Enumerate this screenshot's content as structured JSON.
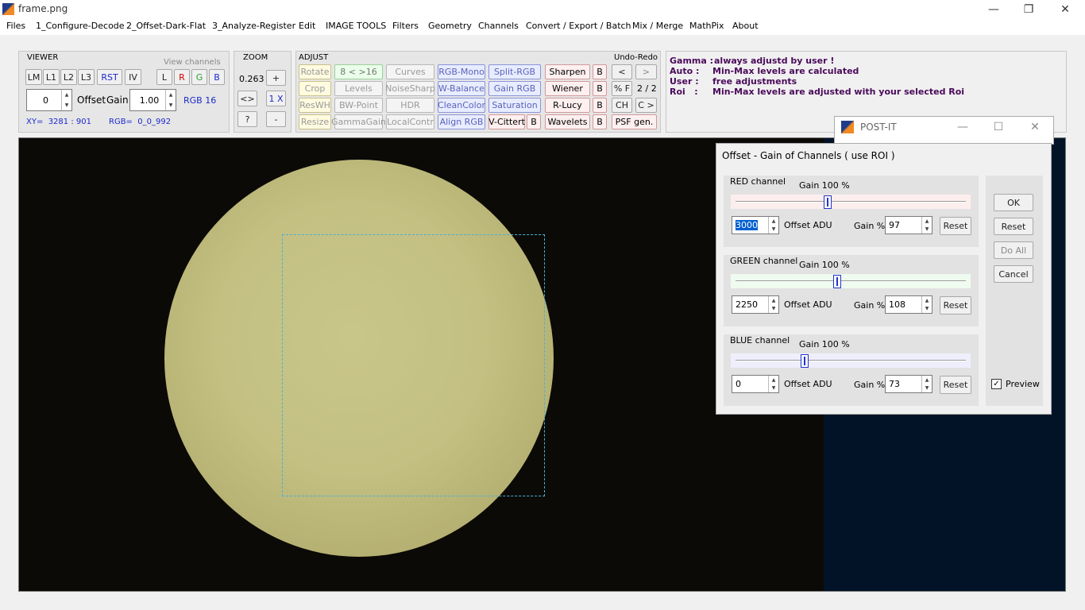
{
  "window": {
    "title": "frame.png",
    "minimize": "—",
    "restore": "❐",
    "close": "✕"
  },
  "menu": [
    "Files",
    "1_Configure-Decode",
    "2_Offset-Dark-Flat",
    "3_Analyze-Register",
    "Edit",
    "IMAGE TOOLS",
    "Filters",
    "Geometry",
    "Channels",
    "Convert / Export / Batch",
    "Mix / Merge",
    "MathPix",
    "About"
  ],
  "viewer": {
    "title": "VIEWER",
    "view_channels_label": "View channels",
    "buttons": [
      "LM",
      "L1",
      "L2",
      "L3",
      "RST",
      "IV"
    ],
    "channels": [
      "L",
      "R",
      "G",
      "B"
    ],
    "offset_value": "0",
    "offset_label": "Offset",
    "gain_label": "Gain",
    "gain_value": "1.00",
    "rgb_mode": "RGB 16",
    "xy": "XY=  3281 : 901",
    "rgb": "RGB=  0_0_992"
  },
  "zoom": {
    "title": "ZOOM",
    "value": "0.263",
    "plus": "+",
    "fit": "<>",
    "one_x": "1 X",
    "help": "?",
    "minus": "-"
  },
  "adjust": {
    "title": "ADJUST",
    "undo_redo_label": "Undo-Redo",
    "col1": [
      "Rotate",
      "Crop",
      "ResWH",
      "Resize"
    ],
    "col2": [
      "8 < >16",
      "Levels",
      "BW-Point",
      "GammaGain"
    ],
    "col3": [
      "Curves",
      "NoiseSharp",
      "HDR",
      "LocalContr"
    ],
    "col4": [
      "RGB-Mono",
      "W-Balance",
      "CleanColor",
      "Align RGB"
    ],
    "col5": [
      "Split-RGB",
      "Gain RGB",
      "Saturation",
      "V-Cittert"
    ],
    "col5_b": "B",
    "col6": [
      "Sharpen",
      "Wiener",
      "R-Lucy",
      "Wavelets"
    ],
    "col6_b": [
      "B",
      "B",
      "B",
      "B"
    ],
    "undo": "<",
    "redo": ">",
    "pct_f": "% F",
    "counter": "2 / 2",
    "ch": "CH",
    "c_next": "C >",
    "psf": "PSF gen."
  },
  "info": {
    "lines": [
      {
        "key": "Gamma :",
        "text": "always adjustd by user !"
      },
      {
        "key": "Auto :",
        "text": "Min-Max levels are calculated"
      },
      {
        "key": "User :",
        "text": "free adjustments"
      },
      {
        "key": "Roi   :",
        "text": "Min-Max levels are adjusted with your selected Roi"
      }
    ]
  },
  "postit": {
    "title": "POST-IT"
  },
  "dialog": {
    "header": "Offset - Gain of Channels  ( use ROI )",
    "channels": [
      {
        "name": "RED channel",
        "gain_caption": "Gain 100 %",
        "offset": "3000",
        "offset_label": "Offset ADU",
        "gain_label": "Gain %",
        "gain": "97",
        "reset": "Reset",
        "slider_pos": 0.4,
        "tint": "#fdeeee"
      },
      {
        "name": "GREEN channel",
        "gain_caption": "Gain 100 %",
        "offset": "2250",
        "offset_label": "Offset ADU",
        "gain_label": "Gain %",
        "gain": "108",
        "reset": "Reset",
        "slider_pos": 0.44,
        "tint": "#eefbee"
      },
      {
        "name": "BLUE channel",
        "gain_caption": "Gain 100 %",
        "offset": "0",
        "offset_label": "Offset ADU",
        "gain_label": "Gain %",
        "gain": "73",
        "reset": "Reset",
        "slider_pos": 0.3,
        "tint": "#eeeefd"
      }
    ],
    "ok": "OK",
    "reset": "Reset",
    "do_all": "Do All",
    "cancel": "Cancel",
    "preview_label": "Preview",
    "preview_checked": "✓"
  }
}
